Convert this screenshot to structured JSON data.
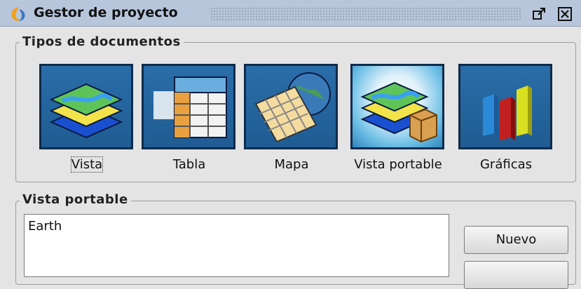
{
  "window": {
    "title": "Gestor de proyecto"
  },
  "document_types": {
    "legend": "Tipos de documentos",
    "items": [
      {
        "label": "Vista",
        "icon": "layered-map-icon"
      },
      {
        "label": "Tabla",
        "icon": "table-icon"
      },
      {
        "label": "Mapa",
        "icon": "map-globe-icon"
      },
      {
        "label": "Vista portable",
        "icon": "portable-view-icon",
        "selected": true
      },
      {
        "label": "Gráficas",
        "icon": "bar-chart-icon"
      }
    ]
  },
  "portable_view": {
    "legend": "Vista portable",
    "items": [
      "Earth"
    ],
    "buttons": {
      "new": "Nuevo"
    }
  },
  "colors": {
    "titlebar": "#b8c6dc",
    "tile": "#2a6da8",
    "tile_border": "#0f2b4a",
    "background": "#e4e4e4"
  }
}
